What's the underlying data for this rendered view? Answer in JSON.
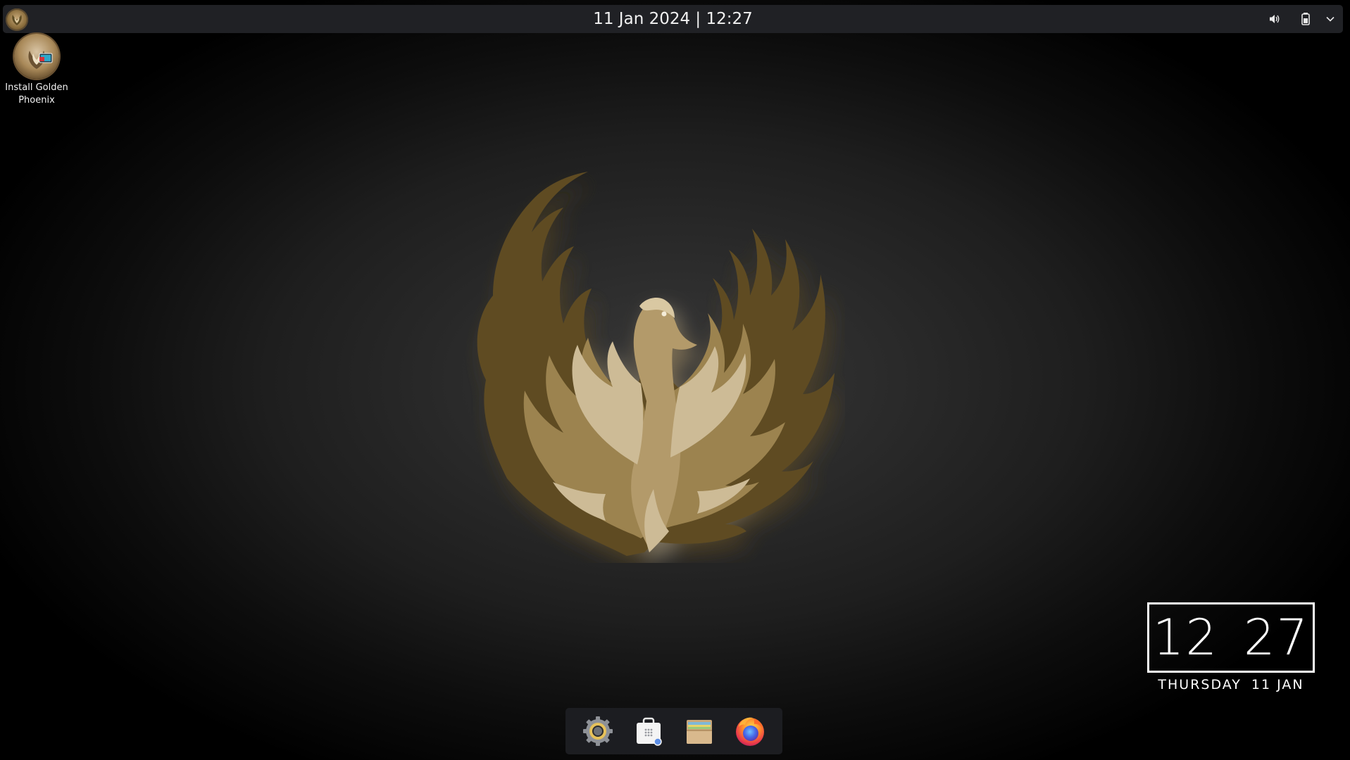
{
  "top_panel": {
    "datetime": "11 Jan 2024 | 12:27",
    "launcher_icon": "phoenix-logo-icon",
    "tray_icons": [
      "volume-icon",
      "battery-icon",
      "chevron-down-icon"
    ]
  },
  "desktop": {
    "icons": [
      {
        "label": "Install Golden Phoenix",
        "icon": "installer-icon"
      }
    ],
    "wallpaper": "golden-phoenix-logo"
  },
  "clock_widget": {
    "hours": "12",
    "minutes": "27",
    "weekday": "THURSDAY",
    "date": "11 JAN"
  },
  "dock": {
    "items": [
      {
        "name": "settings",
        "icon": "gear-icon"
      },
      {
        "name": "software-store",
        "icon": "app-store-bag-icon"
      },
      {
        "name": "files",
        "icon": "file-manager-icon"
      },
      {
        "name": "firefox",
        "icon": "firefox-icon"
      }
    ]
  },
  "colors": {
    "gold": "#b39a6a",
    "gold_dark": "#5e4c24",
    "gold_light": "#cdbb96",
    "panel": "#202125",
    "text": "#f1f1f1"
  }
}
